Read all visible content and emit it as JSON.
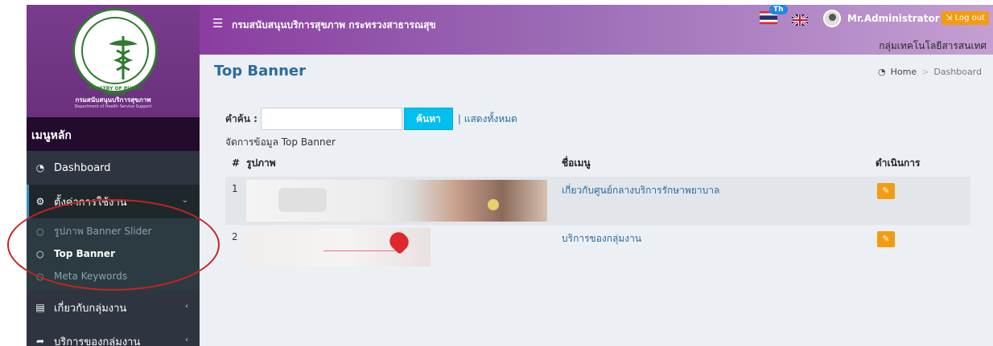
{
  "sidebar": {
    "logo_ring_text": "MINISTRY OF PUBLIC HEALTH",
    "brand_name": "กรมสนับสนุนบริการสุขภาพ",
    "brand_sub": "Department of Health Service Support",
    "menu_header": "เมนูหลัก",
    "items": [
      {
        "label": "Dashboard",
        "icon": "dashboard-icon"
      },
      {
        "label": "ตั้งค่าการใช้งาน",
        "icon": "settings-icon",
        "expanded": true,
        "sub": [
          {
            "label": "รูปภาพ Banner Slider",
            "icon": "circle-icon"
          },
          {
            "label": "Top Banner",
            "icon": "circle-icon",
            "current": true
          },
          {
            "label": "Meta Keywords",
            "icon": "circle-icon"
          }
        ]
      },
      {
        "label": "เกี่ยวกับกลุ่มงาน",
        "icon": "book-icon"
      },
      {
        "label": "บริการของกลุ่มงาน",
        "icon": "share-icon"
      }
    ]
  },
  "topbar": {
    "title": "กรมสนับสนุนบริการสุขภาพ กระทรวงสาธารณสุข",
    "lang_badge": "Th",
    "user_name": "Mr.Administrator",
    "logout_label": "Log out",
    "department": "กลุ่มเทคโนโลยีสารสนเทศ"
  },
  "page": {
    "title": "Top Banner",
    "breadcrumb": [
      "Home",
      "Dashboard"
    ]
  },
  "search": {
    "label": "คำค้น :",
    "value": "",
    "button_label": "ค้นหา",
    "show_all_label": "| แสดงทั้งหมด"
  },
  "table": {
    "caption": "จัดการข้อมูล Top Banner",
    "headers": {
      "num": "#",
      "image": "รูปภาพ",
      "name": "ชื่อเมนู",
      "action": "ดำเนินการ"
    },
    "rows": [
      {
        "num": "1",
        "name": "เกี่ยวกับศูนย์กลางบริการรักษาพยาบาล"
      },
      {
        "num": "2",
        "name": "บริการของกลุ่มงาน"
      }
    ]
  },
  "colors": {
    "sidebar_bg": "#2f3540",
    "brand_purple": "#7a3c8c",
    "topbar_gradient_start": "#8a3da0",
    "accent_blue": "#2c6a9e",
    "search_button": "#00c0ef",
    "edit_button": "#f39c12",
    "annotation_red": "#c9231f"
  }
}
